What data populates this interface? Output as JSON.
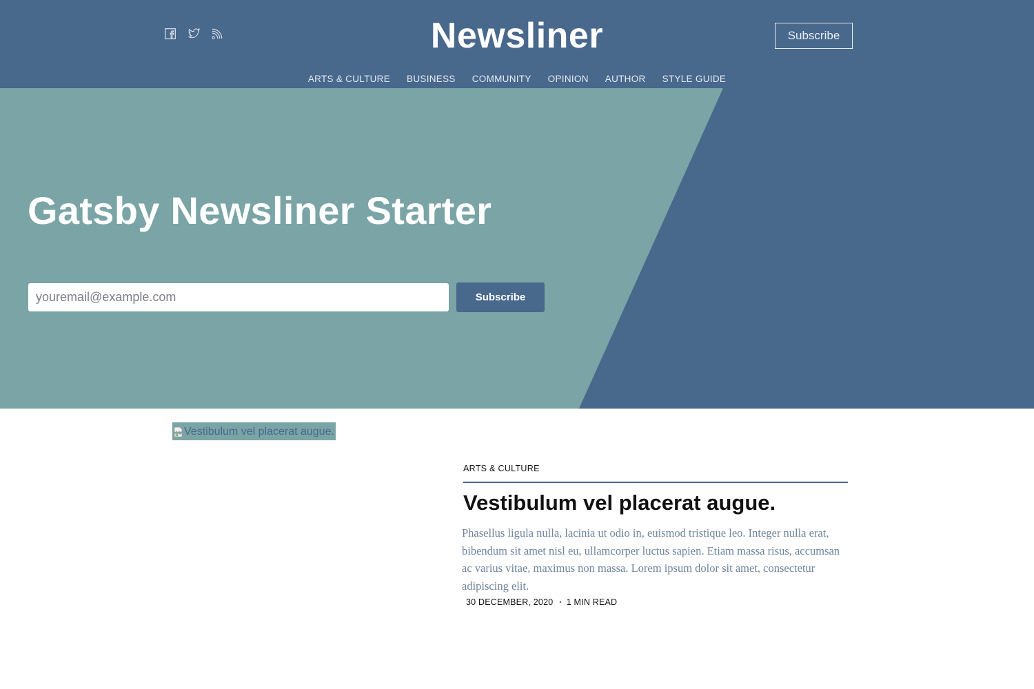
{
  "header": {
    "brand": "Newsliner",
    "subscribe_label": "Subscribe",
    "social_icons": [
      "facebook-icon",
      "twitter-icon",
      "rss-icon"
    ],
    "nav": [
      "ARTS & CULTURE",
      "BUSINESS",
      "COMMUNITY",
      "OPINION",
      "AUTHOR",
      "STYLE GUIDE"
    ]
  },
  "hero": {
    "title": "Gatsby Newsliner Starter",
    "email_placeholder": "youremail@example.com",
    "subscribe_label": "Subscribe"
  },
  "post": {
    "image_alt": "Vestibulum vel placerat augue.",
    "category": "ARTS & CULTURE",
    "title": "Vestibulum vel placerat augue.",
    "excerpt": "Phasellus ligula nulla, lacinia ut odio in, euismod tristique leo. Integer nulla erat, bibendum sit amet nisl eu, ullamcorper luctus sapien. Etiam massa risus, accumsan ac varius vitae, maximus non massa. Lorem ipsum dolor sit amet, consectetur adipiscing elit.",
    "date": "30 DECEMBER, 2020",
    "separator": "•",
    "read_time": "1 MIN READ"
  },
  "colors": {
    "primary": "#48688c",
    "hero_teal": "#7aa4a5",
    "excerpt_text": "#6f859b"
  }
}
